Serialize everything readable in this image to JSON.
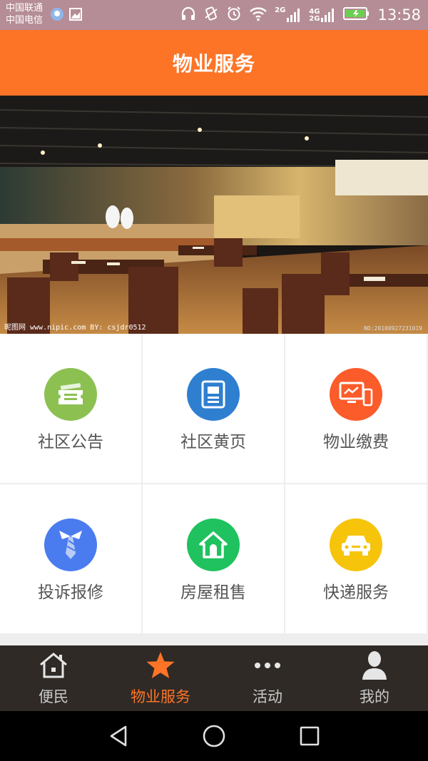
{
  "status_bar": {
    "carrier_1": "中国联通",
    "carrier_2": "中国电信",
    "net_top": "2G",
    "net_4g_a": "4G",
    "net_4g_b": "2G",
    "time": "13:58"
  },
  "header": {
    "title": "物业服务"
  },
  "banner": {
    "watermark": "昵图网 www.nipic.com   BY: csjdr0512",
    "watermark_id": "NO:20100927231019"
  },
  "grid": {
    "items": [
      {
        "label": "社区公告",
        "icon": "ticket-icon",
        "color": "#8cc152"
      },
      {
        "label": "社区黄页",
        "icon": "document-icon",
        "color": "#2f7fd0"
      },
      {
        "label": "物业缴费",
        "icon": "monitor-phone-icon",
        "color": "#fc5b2a"
      },
      {
        "label": "投诉报修",
        "icon": "necktie-icon",
        "color": "#4a7cf0"
      },
      {
        "label": "房屋租售",
        "icon": "house-icon",
        "color": "#1fc25e"
      },
      {
        "label": "快递服务",
        "icon": "car-icon",
        "color": "#f6c40b"
      }
    ]
  },
  "tabs": [
    {
      "label": "便民",
      "icon": "home-icon",
      "active": false
    },
    {
      "label": "物业服务",
      "icon": "star-icon",
      "active": true
    },
    {
      "label": "活动",
      "icon": "more-dots-icon",
      "active": false
    },
    {
      "label": "我的",
      "icon": "user-icon",
      "active": false
    }
  ],
  "colors": {
    "accent": "#fe7427",
    "status_bar": "#b58d96",
    "tab_bar": "#2f2a26"
  }
}
